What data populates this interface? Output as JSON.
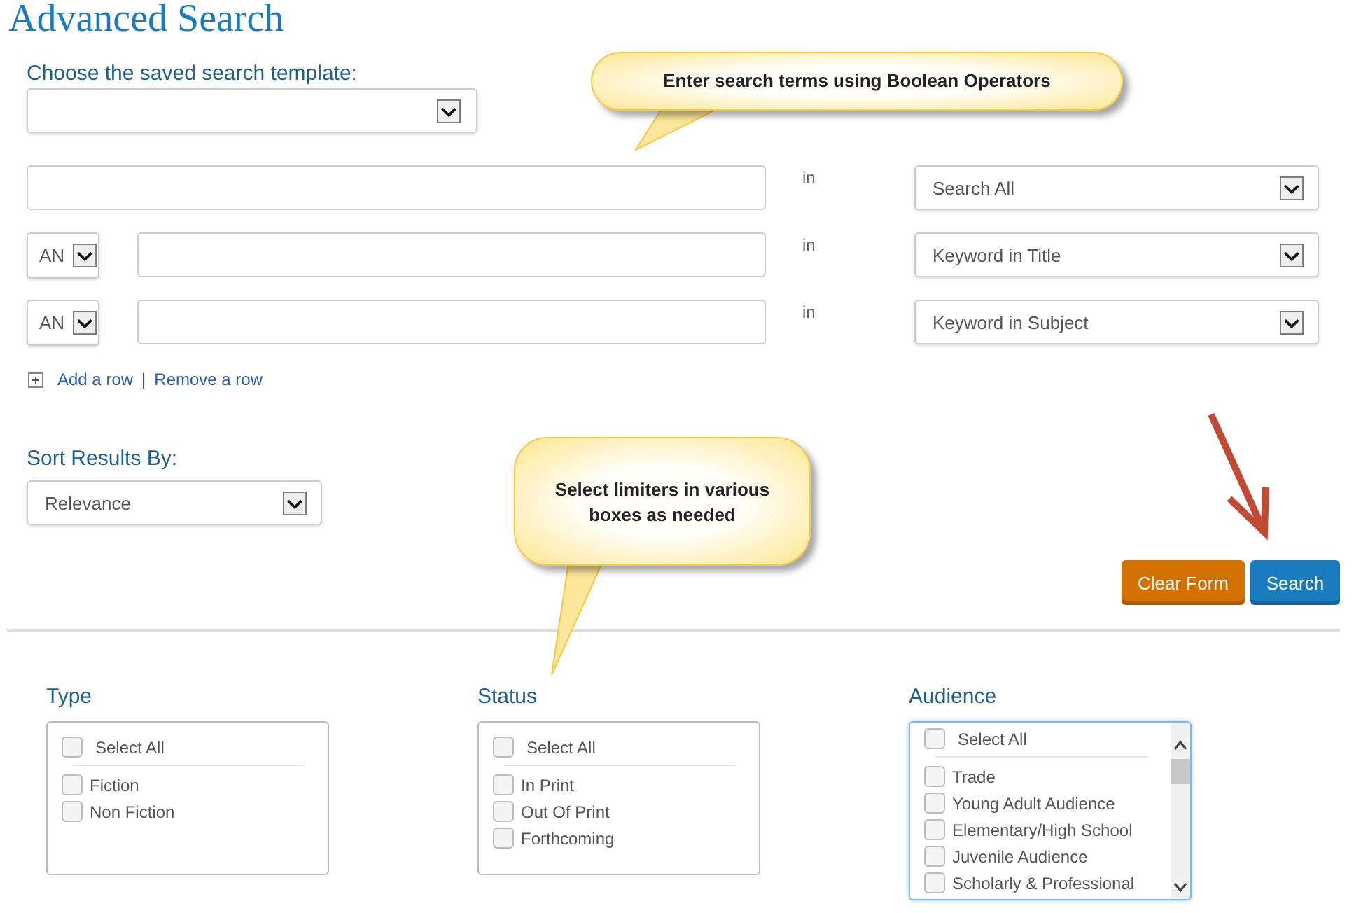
{
  "title": "Advanced Search",
  "template": {
    "label": "Choose the saved search template:"
  },
  "search_rows": [
    {
      "connector": "in",
      "field": "Search All"
    },
    {
      "operator": "AN",
      "connector": "in",
      "field": "Keyword in Title"
    },
    {
      "operator": "AN",
      "connector": "in",
      "field": "Keyword in Subject"
    }
  ],
  "row_links": {
    "add": "Add a row",
    "separator": "|",
    "remove": "Remove a row"
  },
  "sort": {
    "label": "Sort Results By:",
    "value": "Relevance"
  },
  "buttons": [
    {
      "label": "Clear Form",
      "kind": "secondary"
    },
    {
      "label": "Search",
      "kind": "primary"
    }
  ],
  "callouts": [
    {
      "text": "Enter search terms using Boolean Operators",
      "kind": "wide"
    },
    {
      "text": "Select limiters in various boxes as needed",
      "kind": "tall"
    }
  ],
  "facets": [
    {
      "heading": "Type",
      "focused": false,
      "scrollable": false,
      "select_all": {
        "label": "Select All",
        "checked": false
      },
      "options": [
        {
          "label": "Fiction",
          "checked": false
        },
        {
          "label": "Non Fiction",
          "checked": false
        }
      ]
    },
    {
      "heading": "Status",
      "focused": false,
      "scrollable": false,
      "select_all": {
        "label": "Select All",
        "checked": false
      },
      "options": [
        {
          "label": "In Print",
          "checked": false
        },
        {
          "label": "Out Of Print",
          "checked": false
        },
        {
          "label": "Forthcoming",
          "checked": false
        }
      ]
    },
    {
      "heading": "Audience",
      "focused": true,
      "scrollable": true,
      "select_all": {
        "label": "Select All",
        "checked": false
      },
      "options": [
        {
          "label": "Trade",
          "checked": false
        },
        {
          "label": "Young Adult Audience",
          "checked": false
        },
        {
          "label": "Elementary/High School",
          "checked": false
        },
        {
          "label": "Juvenile Audience",
          "checked": false
        },
        {
          "label": "Scholarly & Professional",
          "checked": false
        }
      ]
    }
  ]
}
